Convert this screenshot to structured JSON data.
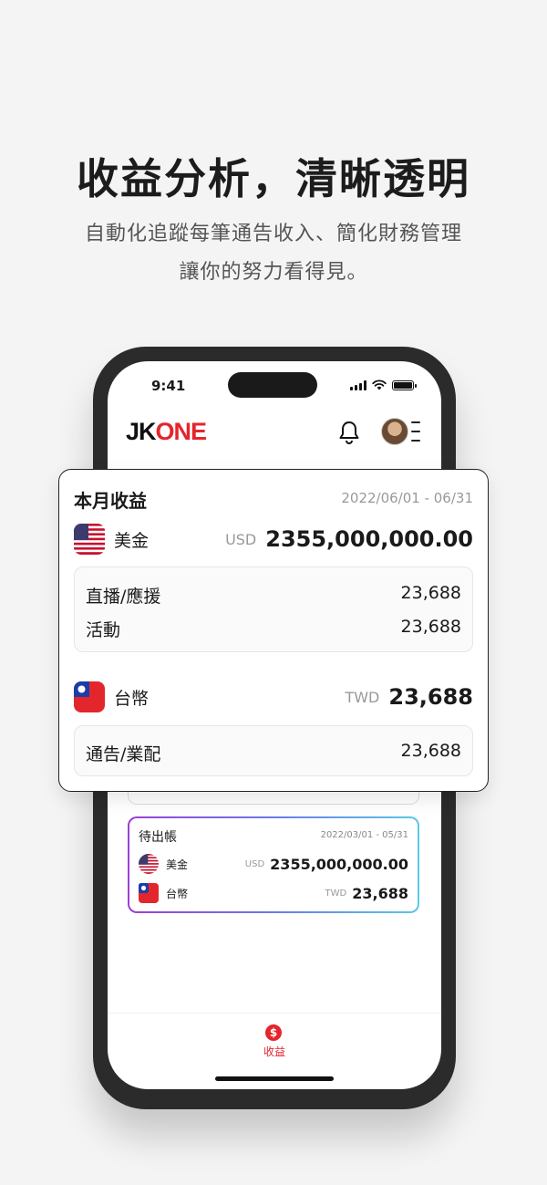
{
  "headline": "收益分析，清晰透明",
  "subline1": "自動化追蹤每筆通告收入、簡化財務管理",
  "subline2": "讓你的努力看得見。",
  "status": {
    "time": "9:41"
  },
  "app": {
    "logo_jk": "JK",
    "logo_one": "ONE"
  },
  "monthly": {
    "title": "本月收益",
    "range": "2022/06/01 - 06/31",
    "usd": {
      "name": "美金",
      "code": "USD",
      "amount": "2355,000,000.00",
      "items": [
        {
          "label": "直播/應援",
          "value": "23,688"
        },
        {
          "label": "活動",
          "value": "23,688"
        }
      ]
    },
    "twd": {
      "name": "台幣",
      "code": "TWD",
      "amount": "23,688",
      "items": [
        {
          "label": "通告/業配",
          "value": "23,688"
        }
      ]
    }
  },
  "pending": {
    "title": "待出帳",
    "range": "2022/03/01 - 05/31",
    "usd": {
      "name": "美金",
      "code": "USD",
      "amount": "2355,000,000.00"
    },
    "twd": {
      "name": "台幣",
      "code": "TWD",
      "amount": "23,688"
    }
  },
  "tabbar": {
    "earnings_icon": "$",
    "earnings_label": "收益"
  },
  "colors": {
    "brand_red": "#e3262c",
    "gradient_start": "#9b3fd6",
    "gradient_end": "#5bc8e8"
  },
  "icons": [
    "bell-icon",
    "avatar",
    "menu-icon",
    "us-flag-icon",
    "taiwan-flag-icon",
    "dollar-icon"
  ]
}
